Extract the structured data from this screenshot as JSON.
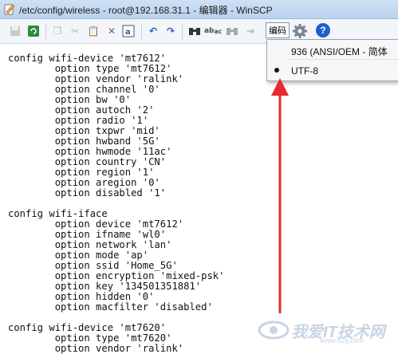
{
  "window": {
    "title": "/etc/config/wireless - root@192.168.31.1 - 编辑器 - WinSCP"
  },
  "toolbar": {
    "icons": [
      "save-icon",
      "reload-icon",
      "copy-icon",
      "cut-icon",
      "paste-icon",
      "delete-icon",
      "select-all-icon",
      "undo-icon",
      "redo-icon",
      "find-icon",
      "replace-icon",
      "find-next-icon",
      "goto-line-icon"
    ],
    "encoding_label": "编码",
    "help_label": "?"
  },
  "encoding_menu": {
    "items": [
      {
        "label": "936   (ANSI/OEM - 简体",
        "selected": false
      },
      {
        "label": "UTF-8",
        "selected": true
      }
    ]
  },
  "editor": {
    "lines": [
      "config wifi-device 'mt7612'",
      "        option type 'mt7612'",
      "        option vendor 'ralink'",
      "        option channel '0'",
      "        option bw '0'",
      "        option autoch '2'",
      "        option radio '1'",
      "        option txpwr 'mid'",
      "        option hwband '5G'",
      "        option hwmode '11ac'",
      "        option country 'CN'",
      "        option region '1'",
      "        option aregion '0'",
      "        option disabled '1'",
      "",
      "config wifi-iface",
      "        option device 'mt7612'",
      "        option ifname 'wl0'",
      "        option network 'lan'",
      "        option mode 'ap'",
      "        option ssid 'Home_5G'",
      "        option encryption 'mixed-psk'",
      "        option key '134501351881'",
      "        option hidden '0'",
      "        option macfilter 'disabled'",
      "",
      "config wifi-device 'mt7620'",
      "        option type 'mt7620'",
      "        option vendor 'ralink'"
    ]
  },
  "watermark": {
    "text": "我爱IT技术网",
    "url": "www.52ij.com"
  },
  "colors": {
    "arrow": "#e8292f",
    "help": "#1f5fc7"
  }
}
